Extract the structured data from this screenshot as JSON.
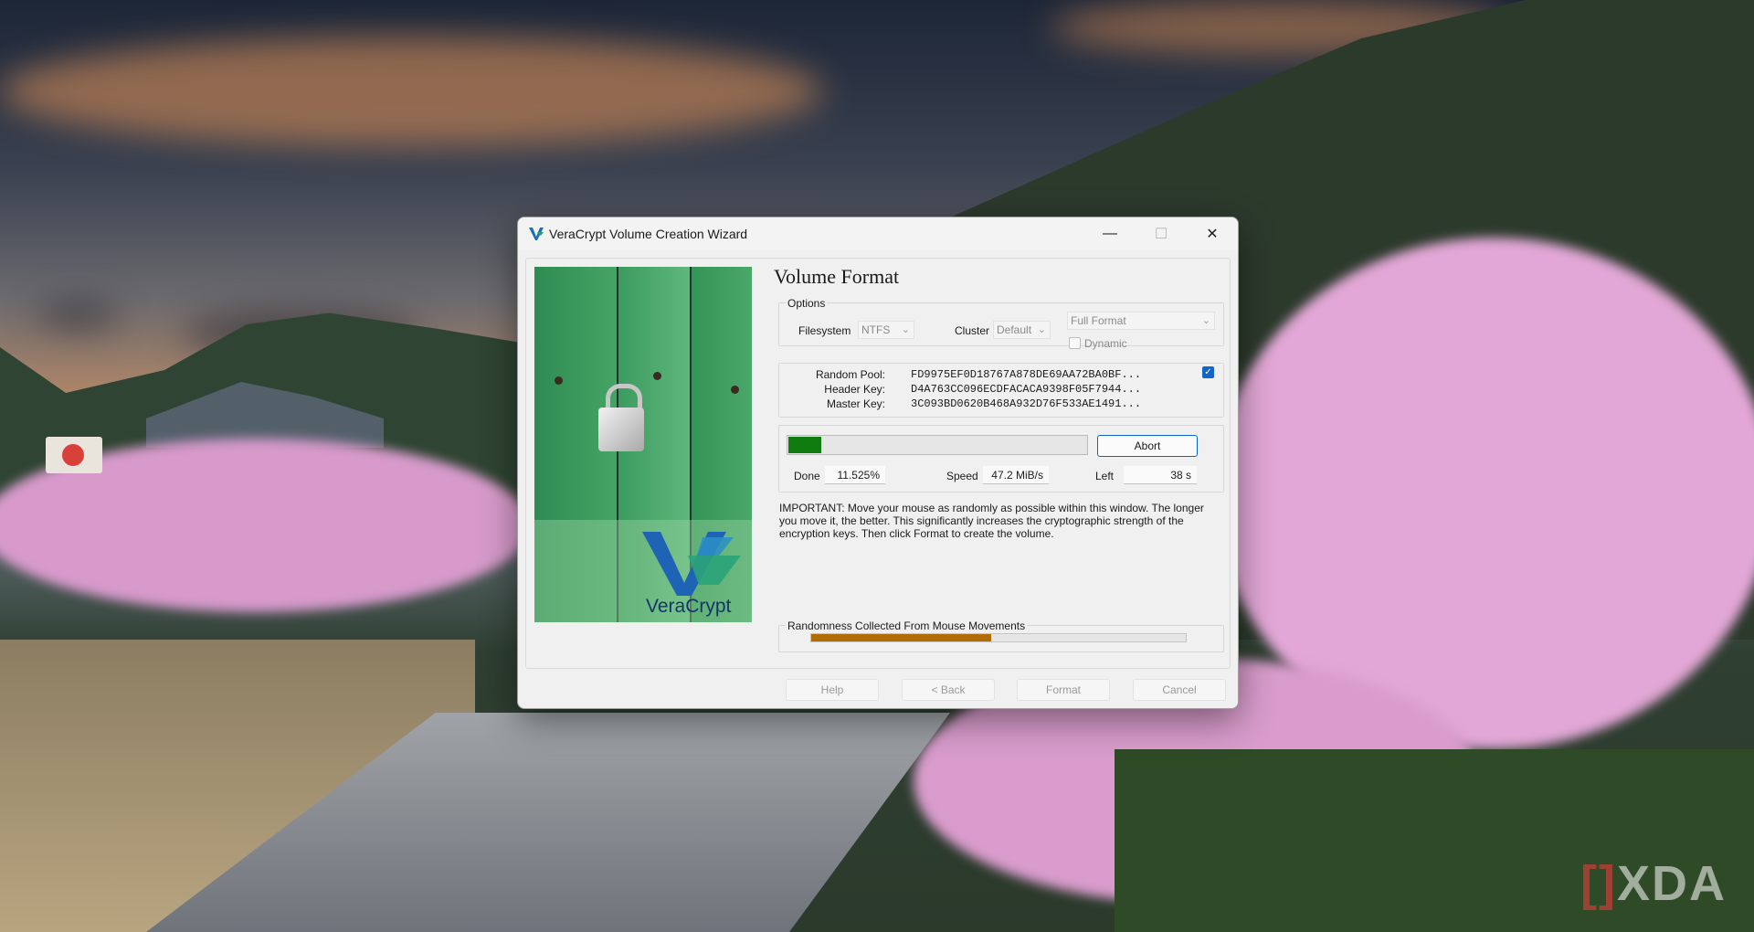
{
  "window": {
    "title": "VeraCrypt Volume Creation Wizard",
    "controls": {
      "minimize": "—",
      "maximize": "☐",
      "close": "✕"
    }
  },
  "side_image": {
    "logo_text": "VeraCrypt"
  },
  "page": {
    "title": "Volume Format"
  },
  "options": {
    "group_label": "Options",
    "filesystem_label": "Filesystem",
    "filesystem_value": "NTFS",
    "cluster_label": "Cluster",
    "cluster_value": "Default",
    "format_mode_value": "Full Format",
    "dynamic_label": "Dynamic",
    "dynamic_checked": false
  },
  "keys": {
    "random_pool_label": "Random Pool:",
    "random_pool_value": "FD9975EF0D18767A878DE69AA72BA0BF...",
    "header_key_label": "Header Key:",
    "header_key_value": "D4A763CC096ECDFACACA9398F05F7944...",
    "master_key_label": "Master Key:",
    "master_key_value": "3C093BD0620B468A932D76F533AE1491...",
    "show_checked": true
  },
  "progress": {
    "fraction": 0.1153,
    "abort_label": "Abort",
    "done_label": "Done",
    "done_value": "11.525%",
    "speed_label": "Speed",
    "speed_value": "47.2 MiB/s",
    "left_label": "Left",
    "left_value": "38 s"
  },
  "note": {
    "text": "IMPORTANT: Move your mouse as randomly as possible within this window. The longer you move it, the better. This significantly increases the cryptographic strength of the encryption keys. Then click Format to create the volume."
  },
  "randomness": {
    "label": "Randomness Collected From Mouse Movements",
    "fraction": 0.48
  },
  "footer": {
    "help_label": "Help",
    "back_label": "< Back",
    "format_label": "Format",
    "cancel_label": "Cancel"
  },
  "watermark": {
    "text": "XDA"
  },
  "colors": {
    "progress_fill": "#0f7b0f",
    "randomness_fill": "#b26c05",
    "accent": "#1266c8"
  }
}
